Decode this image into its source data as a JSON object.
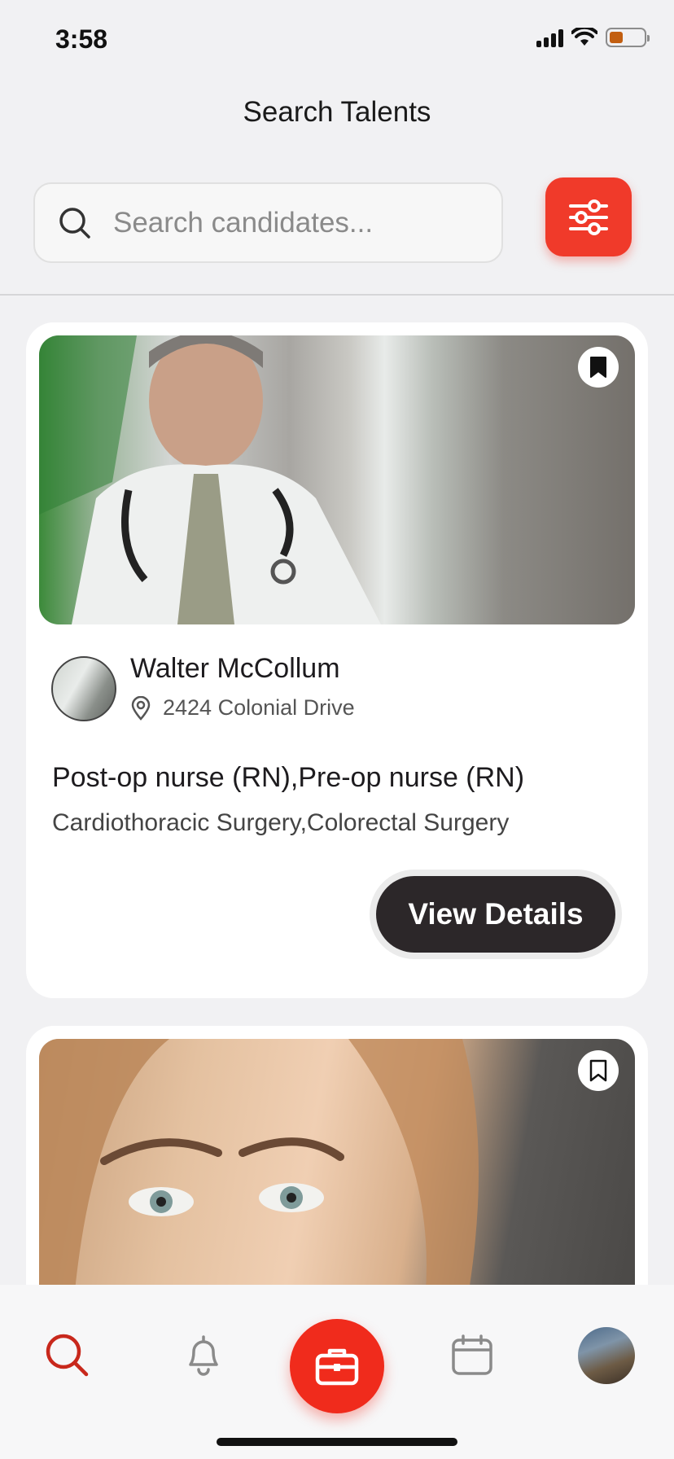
{
  "status_bar": {
    "time": "3:58",
    "battery_level": 0.4,
    "battery_color": "#c25e10"
  },
  "header": {
    "title": "Search Talents"
  },
  "search": {
    "placeholder": "Search candidates...",
    "value": "",
    "icon": "search-icon"
  },
  "filter_button": {
    "icon": "sliders-icon",
    "color": "#f03a2a"
  },
  "candidates": [
    {
      "photo": "doctor-photo",
      "bookmarked": true,
      "name": "Walter McCollum",
      "location": "2424 Colonial Drive",
      "roles": "Post-op nurse (RN),Pre-op nurse (RN)",
      "specialties": "Cardiothoracic Surgery,Colorectal Surgery",
      "action_label": "View Details"
    },
    {
      "photo": "woman-photo",
      "bookmarked": false
    }
  ],
  "bottom_nav": {
    "items": [
      {
        "icon": "search-icon",
        "active": true
      },
      {
        "icon": "bell-icon",
        "active": false
      },
      {
        "icon": "briefcase-icon",
        "active": false
      },
      {
        "icon": "calendar-icon",
        "active": false
      },
      {
        "icon": "profile-avatar",
        "active": false
      }
    ],
    "accent_color": "#f02b1c"
  }
}
